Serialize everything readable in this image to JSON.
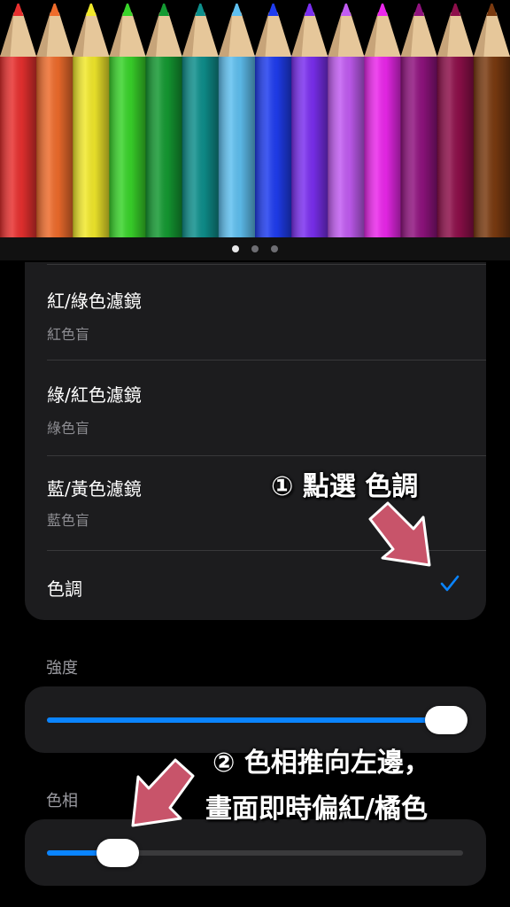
{
  "banner": {
    "pencil_colors": [
      "#e8302f",
      "#ef6c2c",
      "#f2e92b",
      "#39d42a",
      "#149a32",
      "#0e8f8c",
      "#5fc0f0",
      "#1f3df0",
      "#7b2ff0",
      "#c25cf2",
      "#ec27ec",
      "#90137f",
      "#8e0f4a",
      "#7a3a10"
    ],
    "page_count": 3,
    "active_page": 1
  },
  "filters": [
    {
      "title": "紅/綠色濾鏡",
      "subtitle": "紅色盲"
    },
    {
      "title": "綠/紅色濾鏡",
      "subtitle": "綠色盲"
    },
    {
      "title": "藍/黃色濾鏡",
      "subtitle": "藍色盲"
    },
    {
      "title": "色調",
      "subtitle": "",
      "selected": true
    }
  ],
  "intensity": {
    "label": "強度",
    "value_fraction": 0.96
  },
  "hue": {
    "label": "色相",
    "value_fraction": 0.17
  },
  "annotations": {
    "step1": "① 點選 色調",
    "step2_line1": "② 色相推向左邊，",
    "step2_line2": "畫面即時偏紅/橘色"
  },
  "colors": {
    "accent": "#0a84ff",
    "card": "#1c1c1e",
    "annotation_arrow": "#c8546a"
  }
}
